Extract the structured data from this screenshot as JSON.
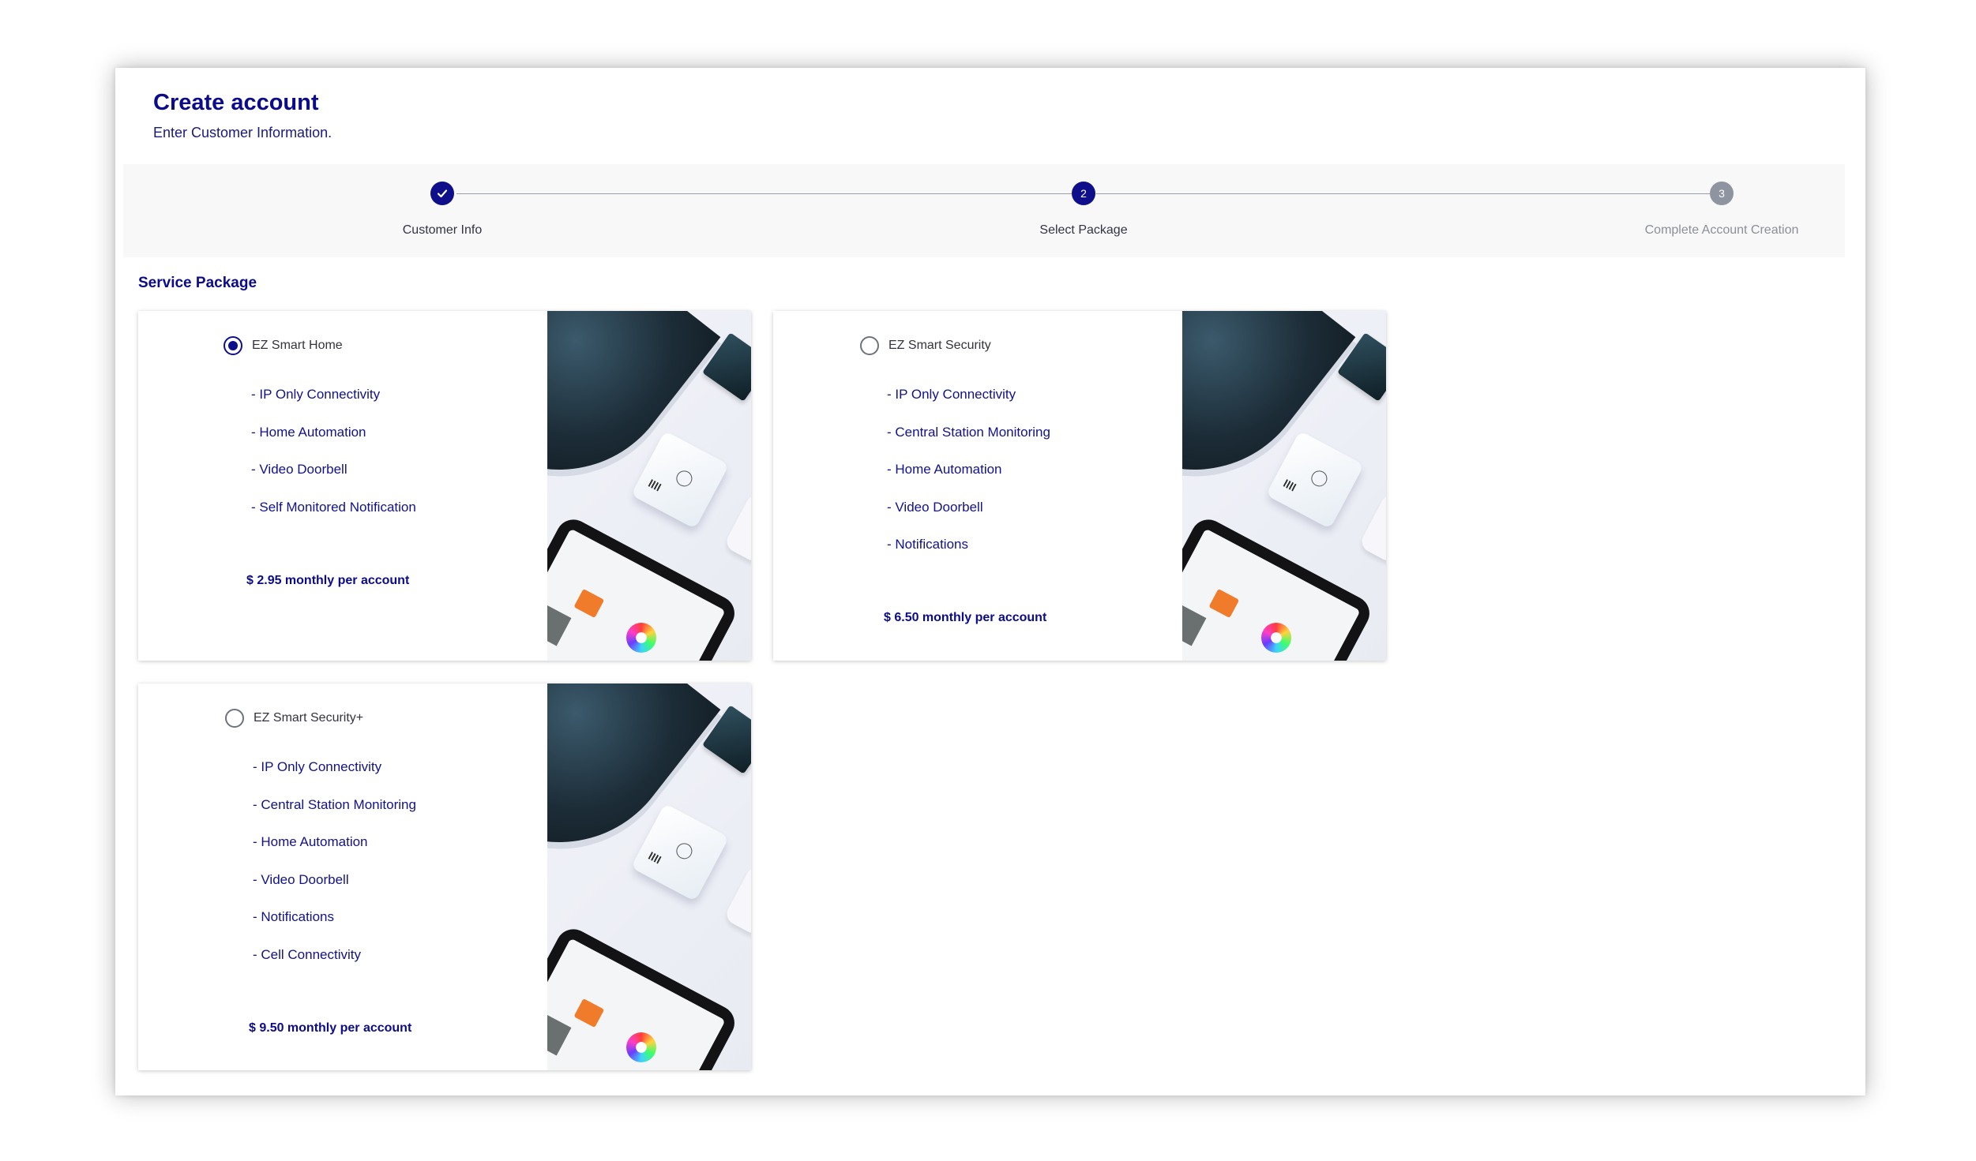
{
  "header": {
    "title": "Create account",
    "subtitle": "Enter Customer Information."
  },
  "stepper": {
    "steps": [
      {
        "number": "1",
        "label": "Customer Info",
        "state": "completed"
      },
      {
        "number": "2",
        "label": "Select Package",
        "state": "active"
      },
      {
        "number": "3",
        "label": "Complete Account Creation",
        "state": "pending"
      }
    ]
  },
  "section": {
    "title": "Service Package"
  },
  "packages": [
    {
      "name": "EZ Smart Home",
      "selected": true,
      "features": [
        "- IP Only Connectivity",
        "- Home Automation",
        "- Video Doorbell",
        "- Self Monitored Notification"
      ],
      "price": "$ 2.95 monthly per account"
    },
    {
      "name": "EZ Smart Security",
      "selected": false,
      "features": [
        "- IP Only Connectivity",
        "- Central Station Monitoring",
        "- Home Automation",
        "- Video Doorbell",
        "- Notifications"
      ],
      "price": "$ 6.50 monthly per account"
    },
    {
      "name": "EZ Smart Security+",
      "selected": false,
      "features": [
        "- IP Only Connectivity",
        "- Central Station Monitoring",
        "- Home Automation",
        "- Video Doorbell",
        "- Notifications",
        "- Cell Connectivity"
      ],
      "price": "$ 9.50 monthly per account"
    }
  ],
  "colors": {
    "accent": "#0f0f8c",
    "pending": "#8e94a0"
  },
  "icons": {
    "completed_step": "check-icon",
    "package_image": "smart-home-devices-image"
  }
}
